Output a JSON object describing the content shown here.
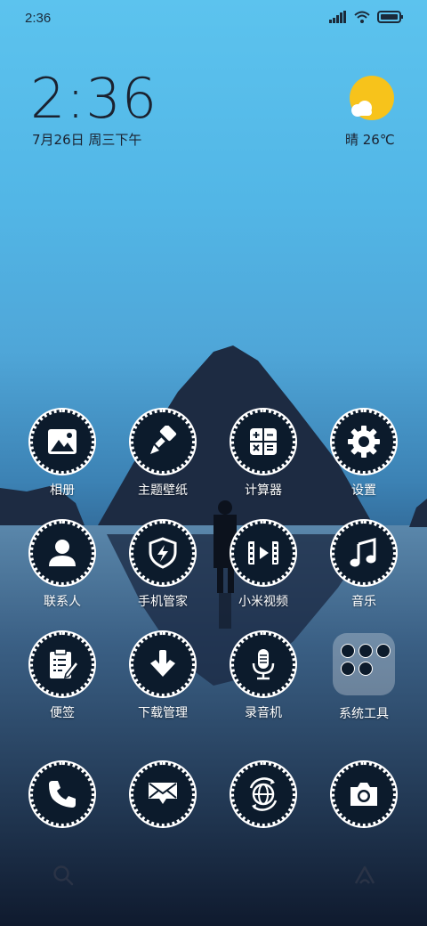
{
  "status_bar": {
    "time": "2:36"
  },
  "clock": {
    "time": "2:36",
    "date": "7月26日 周三下午"
  },
  "weather": {
    "text": "晴 26℃"
  },
  "apps": {
    "gallery": "相册",
    "themes": "主题壁纸",
    "calculator": "计算器",
    "settings": "设置",
    "contacts": "联系人",
    "security": "手机管家",
    "video": "小米视频",
    "music": "音乐",
    "notes": "便签",
    "downloads": "下载管理",
    "recorder": "录音机",
    "tools_folder": "系统工具"
  },
  "colors": {
    "icon_bg": "#0c1b2c",
    "icon_ring": "#ffffff",
    "sun": "#f7c31b"
  }
}
